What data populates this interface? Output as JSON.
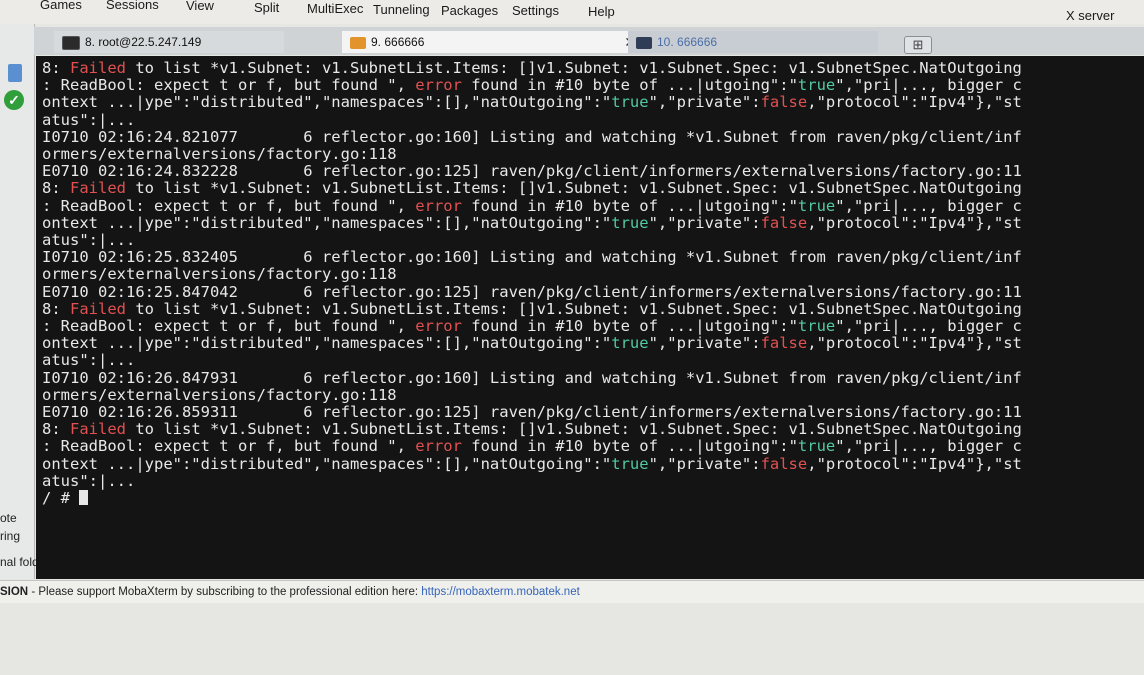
{
  "menu": {
    "items": [
      "Games",
      "Sessions",
      "View",
      "Split",
      "MultiExec",
      "Tunneling",
      "Packages",
      "Settings",
      "Help"
    ],
    "xserver_label": "X server"
  },
  "tabs": [
    {
      "label": "8. root@22.5.247.149"
    },
    {
      "label": "9. 666666"
    },
    {
      "label": "10. 666666"
    }
  ],
  "sidebar": {
    "labels": [
      "ote",
      "ring",
      "nal fold"
    ]
  },
  "terminal": {
    "lines": [
      [
        {
          "t": "8: "
        },
        {
          "t": "Failed",
          "c": "red"
        },
        {
          "t": " to list *v1.Subnet: v1.SubnetList.Items: []v1.Subnet: v1.Subnet.Spec: v1.SubnetSpec.NatOutgoing"
        }
      ],
      [
        {
          "t": ": ReadBool: expect t or f, but found \", "
        },
        {
          "t": "error",
          "c": "red"
        },
        {
          "t": " found in #10 byte of ...|utgoing\":\""
        },
        {
          "t": "true",
          "c": "grn"
        },
        {
          "t": "\",\"pri|..., bigger c"
        }
      ],
      [
        {
          "t": "ontext ...|ype\":\"distributed\",\"namespaces\":[],\"natOutgoing\":\""
        },
        {
          "t": "true",
          "c": "grn"
        },
        {
          "t": "\",\"private\":"
        },
        {
          "t": "false",
          "c": "red"
        },
        {
          "t": ",\"protocol\":\"Ipv4\"},\"st"
        }
      ],
      [
        {
          "t": "atus\":|..."
        }
      ],
      [
        {
          "t": "I0710 02:16:24.821077       6 reflector.go:160] Listing and watching *v1.Subnet from raven/pkg/client/inf"
        }
      ],
      [
        {
          "t": "ormers/externalversions/factory.go:118"
        }
      ],
      [
        {
          "t": "E0710 02:16:24.832228       6 reflector.go:125] raven/pkg/client/informers/externalversions/factory.go:11"
        }
      ],
      [
        {
          "t": "8: "
        },
        {
          "t": "Failed",
          "c": "red"
        },
        {
          "t": " to list *v1.Subnet: v1.SubnetList.Items: []v1.Subnet: v1.Subnet.Spec: v1.SubnetSpec.NatOutgoing"
        }
      ],
      [
        {
          "t": ": ReadBool: expect t or f, but found \", "
        },
        {
          "t": "error",
          "c": "red"
        },
        {
          "t": " found in #10 byte of ...|utgoing\":\""
        },
        {
          "t": "true",
          "c": "grn"
        },
        {
          "t": "\",\"pri|..., bigger c"
        }
      ],
      [
        {
          "t": "ontext ...|ype\":\"distributed\",\"namespaces\":[],\"natOutgoing\":\""
        },
        {
          "t": "true",
          "c": "grn"
        },
        {
          "t": "\",\"private\":"
        },
        {
          "t": "false",
          "c": "red"
        },
        {
          "t": ",\"protocol\":\"Ipv4\"},\"st"
        }
      ],
      [
        {
          "t": "atus\":|..."
        }
      ],
      [
        {
          "t": "I0710 02:16:25.832405       6 reflector.go:160] Listing and watching *v1.Subnet from raven/pkg/client/inf"
        }
      ],
      [
        {
          "t": "ormers/externalversions/factory.go:118"
        }
      ],
      [
        {
          "t": "E0710 02:16:25.847042       6 reflector.go:125] raven/pkg/client/informers/externalversions/factory.go:11"
        }
      ],
      [
        {
          "t": "8: "
        },
        {
          "t": "Failed",
          "c": "red"
        },
        {
          "t": " to list *v1.Subnet: v1.SubnetList.Items: []v1.Subnet: v1.Subnet.Spec: v1.SubnetSpec.NatOutgoing"
        }
      ],
      [
        {
          "t": ": ReadBool: expect t or f, but found \", "
        },
        {
          "t": "error",
          "c": "red"
        },
        {
          "t": " found in #10 byte of ...|utgoing\":\""
        },
        {
          "t": "true",
          "c": "grn"
        },
        {
          "t": "\",\"pri|..., bigger c"
        }
      ],
      [
        {
          "t": "ontext ...|ype\":\"distributed\",\"namespaces\":[],\"natOutgoing\":\""
        },
        {
          "t": "true",
          "c": "grn"
        },
        {
          "t": "\",\"private\":"
        },
        {
          "t": "false",
          "c": "red"
        },
        {
          "t": ",\"protocol\":\"Ipv4\"},\"st"
        }
      ],
      [
        {
          "t": "atus\":|..."
        }
      ],
      [
        {
          "t": "I0710 02:16:26.847931       6 reflector.go:160] Listing and watching *v1.Subnet from raven/pkg/client/inf"
        }
      ],
      [
        {
          "t": "ormers/externalversions/factory.go:118"
        }
      ],
      [
        {
          "t": "E0710 02:16:26.859311       6 reflector.go:125] raven/pkg/client/informers/externalversions/factory.go:11"
        }
      ],
      [
        {
          "t": "8: "
        },
        {
          "t": "Failed",
          "c": "red"
        },
        {
          "t": " to list *v1.Subnet: v1.SubnetList.Items: []v1.Subnet: v1.Subnet.Spec: v1.SubnetSpec.NatOutgoing"
        }
      ],
      [
        {
          "t": ": ReadBool: expect t or f, but found \", "
        },
        {
          "t": "error",
          "c": "red"
        },
        {
          "t": " found in #10 byte of ...|utgoing\":\""
        },
        {
          "t": "true",
          "c": "grn"
        },
        {
          "t": "\",\"pri|..., bigger c"
        }
      ],
      [
        {
          "t": "ontext ...|ype\":\"distributed\",\"namespaces\":[],\"natOutgoing\":\""
        },
        {
          "t": "true",
          "c": "grn"
        },
        {
          "t": "\",\"private\":"
        },
        {
          "t": "false",
          "c": "red"
        },
        {
          "t": ",\"protocol\":\"Ipv4\"},\"st"
        }
      ],
      [
        {
          "t": "atus\":|..."
        }
      ]
    ],
    "prompt": "/ # "
  },
  "status": {
    "label": "SION",
    "message": " - Please support MobaXterm by subscribing to the professional edition here: ",
    "link": "https://mobaxterm.mobatek.net"
  }
}
